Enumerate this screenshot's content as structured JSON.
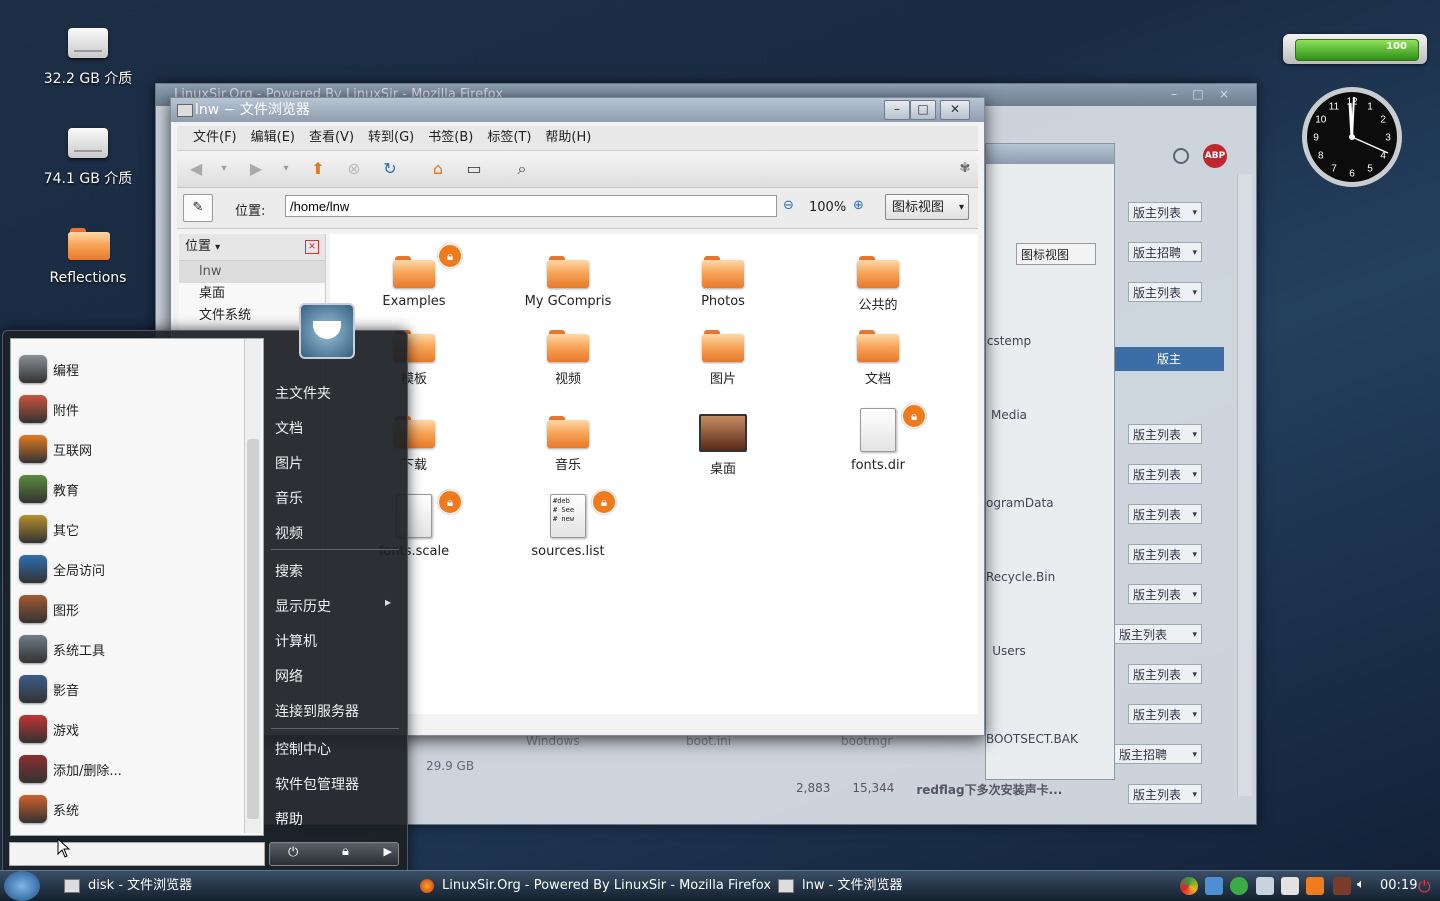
{
  "desktop": {
    "icons": [
      {
        "label": "32.2 GB 介质"
      },
      {
        "label": "74.1 GB 介质"
      },
      {
        "label": "Reflections"
      }
    ]
  },
  "battery": {
    "value": "100",
    "level_percent": 100
  },
  "clock_widget": {
    "numerals": [
      "12",
      "1",
      "2",
      "3",
      "4",
      "5",
      "6",
      "7",
      "8",
      "9",
      "10",
      "11"
    ]
  },
  "firefox_window": {
    "title": "LinuxSir.Org - Powered By LinuxSir - Mozilla Firefox"
  },
  "background_window": {
    "view_select": "图标视图",
    "items": [
      "cstemp",
      "Media",
      "ogramData",
      "Recycle.Bin",
      "Users",
      "BOOTSECT.BAK",
      "Windows",
      "boot.ini",
      "bootmgr"
    ],
    "size_text": "29.9 GB",
    "sidebar_header": "版主",
    "select_options": [
      "版主列表",
      "版主招聘",
      "版主列表",
      "版主列表",
      "版主列表",
      "版主列表",
      "版主列表",
      "版主列表",
      "版主列表",
      "版主列表",
      "版主列表",
      "版主招聘",
      "版主列表"
    ],
    "forum_numbers": [
      "2,883",
      "15,344"
    ],
    "forum_post": "redflag下多次安装声卡..."
  },
  "file_browser": {
    "title": "lnw − 文件浏览器",
    "menu": [
      "文件(F)",
      "编辑(E)",
      "查看(V)",
      "转到(G)",
      "书签(B)",
      "标签(T)",
      "帮助(H)"
    ],
    "location_label": "位置:",
    "location_value": "/home/lnw",
    "zoom": "100%",
    "view_mode": "图标视图",
    "sidebar_header": "位置",
    "sidebar_items": [
      "lnw",
      "桌面",
      "文件系统"
    ],
    "files": [
      {
        "name": "Examples",
        "type": "folder",
        "locked": true
      },
      {
        "name": "My GCompris",
        "type": "folder"
      },
      {
        "name": "Photos",
        "type": "folder"
      },
      {
        "name": "公共的",
        "type": "folder"
      },
      {
        "name": "模板",
        "type": "folder"
      },
      {
        "name": "视频",
        "type": "folder"
      },
      {
        "name": "图片",
        "type": "folder"
      },
      {
        "name": "文档",
        "type": "folder"
      },
      {
        "name": "下载",
        "type": "folder"
      },
      {
        "name": "音乐",
        "type": "folder"
      },
      {
        "name": "桌面",
        "type": "desktop"
      },
      {
        "name": "fonts.dir",
        "type": "file",
        "locked": true
      },
      {
        "name": "fonts.scale",
        "type": "file",
        "locked": true
      },
      {
        "name": "sources.list",
        "type": "file",
        "locked": true,
        "preview": [
          "#deb",
          "# See",
          "# new"
        ]
      }
    ]
  },
  "start_menu": {
    "categories": [
      "编程",
      "附件",
      "互联网",
      "教育",
      "其它",
      "全局访问",
      "图形",
      "系统工具",
      "影音",
      "游戏",
      "添加/删除...",
      "系统"
    ],
    "places": [
      "主文件夹",
      "文档",
      "图片",
      "音乐",
      "视频"
    ],
    "actions": [
      "搜索",
      "显示历史",
      "计算机",
      "网络",
      "连接到服务器"
    ],
    "system": [
      "控制中心",
      "软件包管理器",
      "帮助"
    ],
    "search_value": ""
  },
  "taskbar": {
    "tasks": [
      "disk - 文件浏览器",
      "LinuxSir.Org - Powered By LinuxSir - Mozilla Firefox",
      "lnw - 文件浏览器"
    ],
    "time": "00:19"
  },
  "colors": {
    "accent": "#ef7b1d",
    "folder": "#f7a65a",
    "taskbar": "#1c2a3a"
  }
}
